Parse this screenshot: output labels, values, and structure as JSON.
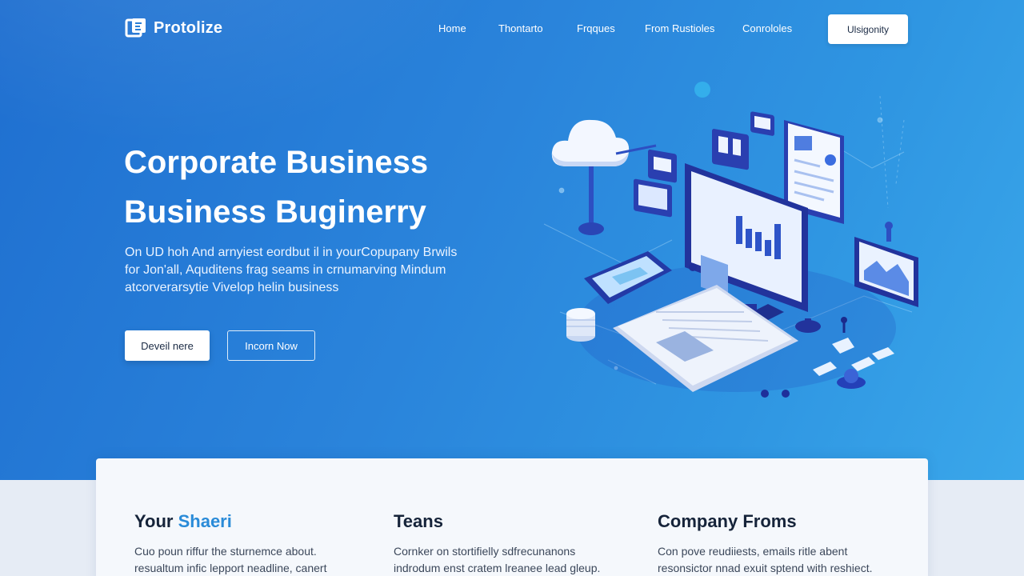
{
  "brand": {
    "name": "Protolize"
  },
  "nav": {
    "items": [
      "Home",
      "Thontarto",
      "Frqques",
      "From Rustioles",
      "Conrololes"
    ],
    "cta_label": "Ulsigonity"
  },
  "hero": {
    "headline_line1": "Corporate Business",
    "headline_line2": "Business Buginerry",
    "description_line1": "On UD hoh And arnyiest eordbut il in yourCopupany Brwils",
    "description_line2": "for Jon'all, Aquditens frag seams in crnumarving  Mindum",
    "description_line3": "atcorverarsytie Vivelop helin business",
    "primary_button": "Deveil nere",
    "secondary_button": "Incorn Now"
  },
  "cards": [
    {
      "title_prefix": "Your ",
      "title_accent": "Shaeri",
      "body_line1": "Cuo poun riffur the sturnemce about.",
      "body_line2": "resualtum infic lepport neadline, canert"
    },
    {
      "title_prefix": "Teans",
      "title_accent": "",
      "body_line1": "Cornker on stortifielly sdfrecunanons",
      "body_line2": "indrodum enst cratem lreanee lead gleup."
    },
    {
      "title_prefix": "Company Froms",
      "title_accent": "",
      "body_line1": "Con pove reudiiests, emails ritle abent",
      "body_line2": "resonsictor nnad exuit sptend with reshiect."
    }
  ],
  "colors": {
    "hero_start": "#1f6fd0",
    "hero_end": "#3aa7ea",
    "accent": "#2a8bd8",
    "text_dark": "#16243a"
  }
}
